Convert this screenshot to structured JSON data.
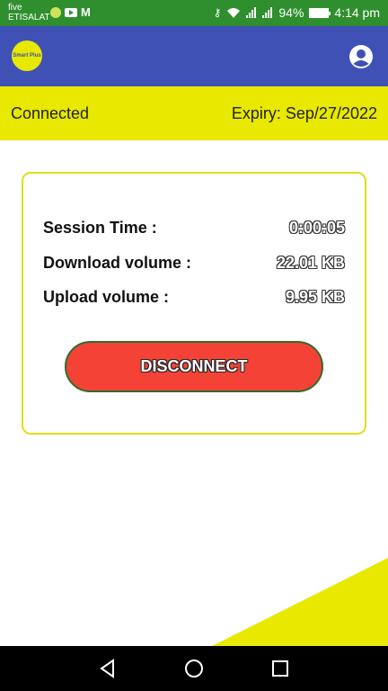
{
  "status_bar": {
    "carrier_line1": "five",
    "carrier_line2": "ETISALAT",
    "battery_percent": "94%",
    "time": "4:14 pm",
    "icons": [
      "notification-dot-icon",
      "youtube-icon",
      "gmail-icon",
      "key-icon",
      "wifi-icon",
      "signal-icon",
      "signal-icon",
      "battery-icon"
    ]
  },
  "app_bar": {
    "logo_text": "Smart Plus",
    "account_icon": "account-circle-icon"
  },
  "connection": {
    "status": "Connected",
    "expiry": "Expiry: Sep/27/2022"
  },
  "session": {
    "rows": [
      {
        "label": "Session Time :",
        "value": "0:00:05"
      },
      {
        "label": "Download volume :",
        "value": "22.01 KB"
      },
      {
        "label": "Upload volume :",
        "value": "9.95 KB"
      }
    ],
    "disconnect_label": "DISCONNECT"
  },
  "colors": {
    "status_bar": "#2f8f2f",
    "app_bar": "#3f51b5",
    "accent_yellow": "#e8e800",
    "disconnect_red": "#f44336"
  },
  "nav_bar": {
    "icons": [
      "back-icon",
      "home-icon",
      "recents-icon"
    ]
  }
}
